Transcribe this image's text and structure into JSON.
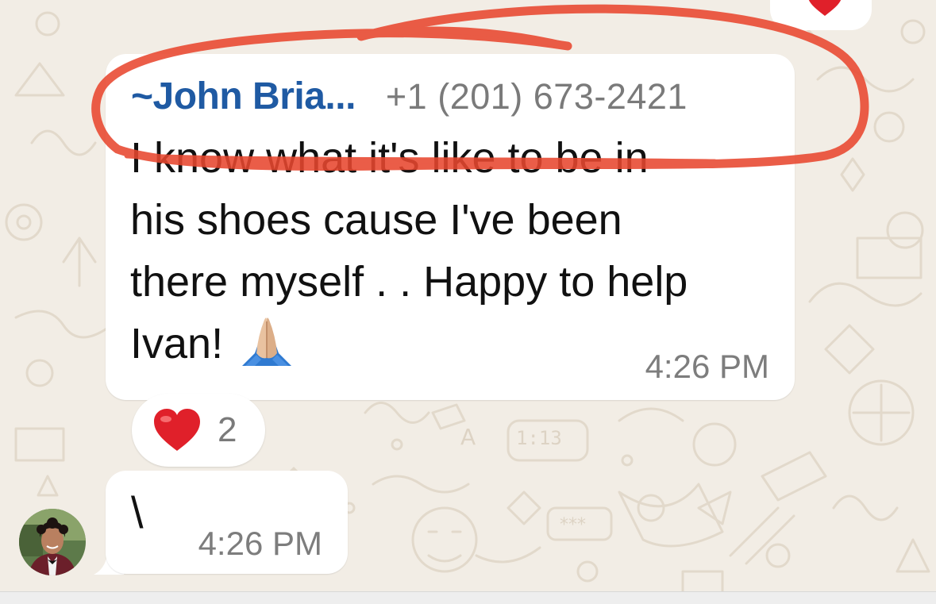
{
  "colors": {
    "background": "#f2ede5",
    "bubble": "#ffffff",
    "sender_name": "#1f5aa3",
    "meta_text": "#7d7d7d",
    "annotation": "#e8472f",
    "heart": "#e0202a"
  },
  "previous_message": {
    "reaction_icon": "heart-icon"
  },
  "message": {
    "sender_name": "~John Bria...",
    "sender_phone": "+1 (201) 673-2421",
    "text_lines": [
      "I know what it's like to be in",
      "his shoes cause I've been",
      "there myself . . Happy to help",
      "Ivan!"
    ],
    "emoji": "folded-hands-emoji",
    "time": "4:26 PM",
    "reaction": {
      "icon": "heart-icon",
      "count": "2"
    }
  },
  "reply": {
    "text": "\\",
    "time": "4:26 PM",
    "avatar": "user-avatar"
  }
}
